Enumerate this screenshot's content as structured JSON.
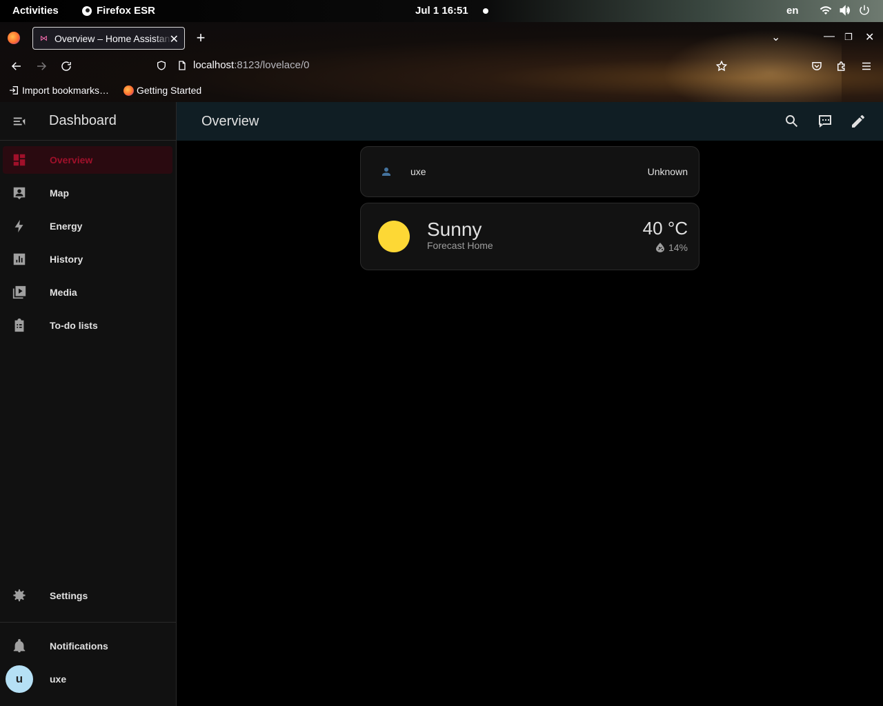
{
  "gnome": {
    "activities": "Activities",
    "app_name": "Firefox ESR",
    "clock": "Jul 1  16:51",
    "lang": "en"
  },
  "browser": {
    "tab_title": "Overview – Home Assistant",
    "url_host": "localhost",
    "url_path": ":8123/lovelace/0",
    "bookmarks": [
      "Import bookmarks…",
      "Getting Started"
    ]
  },
  "sidebar": {
    "title": "Dashboard",
    "items": [
      {
        "label": "Overview",
        "icon": "view-dashboard-icon"
      },
      {
        "label": "Map",
        "icon": "account-box-icon"
      },
      {
        "label": "Energy",
        "icon": "lightning-bolt-icon"
      },
      {
        "label": "History",
        "icon": "chart-box-icon"
      },
      {
        "label": "Media",
        "icon": "play-box-multiple-icon"
      },
      {
        "label": "To-do lists",
        "icon": "clipboard-list-icon"
      }
    ],
    "settings": "Settings",
    "notifications": "Notifications",
    "user": {
      "initial": "u",
      "name": "uxe"
    }
  },
  "header": {
    "title": "Overview"
  },
  "cards": {
    "person": {
      "name": "uxe",
      "state": "Unknown"
    },
    "weather": {
      "condition": "Sunny",
      "name": "Forecast Home",
      "temperature": "40 °C",
      "humidity": "14%"
    }
  },
  "colors": {
    "accent": "#a0102a",
    "sun": "#fdd835",
    "person_icon": "#44739e",
    "header_bg": "#101e24"
  }
}
